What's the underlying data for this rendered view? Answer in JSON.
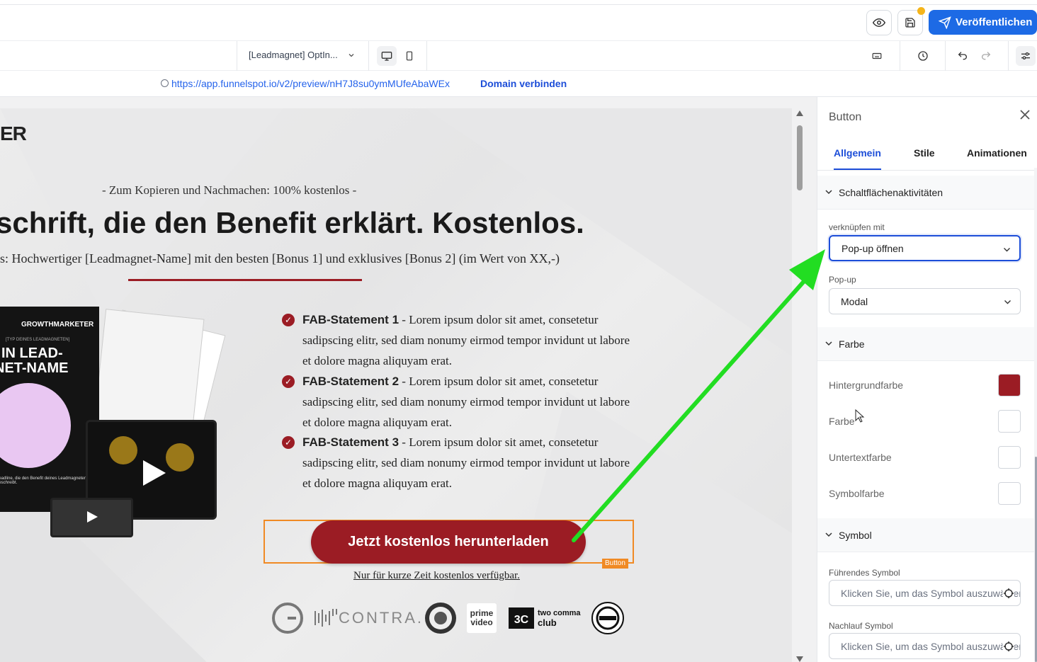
{
  "topbar": {
    "publish_label": "Veröffentlichen"
  },
  "toolbar": {
    "page_select": "[Leadmagnet] OptIn...",
    "url": "https://app.funnelspot.io/v2/preview/nH7J8su0ymMUfeAbaWEx",
    "domain_link": "Domain verbinden"
  },
  "canvas": {
    "logo_fragment": "ER",
    "pre_headline": "- Zum Kopieren und Nachmachen: 100% kostenlos -",
    "headline": "schrift, die den Benefit erklärt. Kostenlos.",
    "subline": "s: Hochwertiger [Leadmagnet-Name] mit den besten [Bonus 1] und exklusives [Bonus 2] (im Wert von XX,-)",
    "fab_items": [
      {
        "title": "FAB-Statement 1",
        "text": " - Lorem ipsum dolor sit amet, consetetur sadipscing elitr, sed diam nonumy eirmod tempor invidunt ut labore et dolore magna aliquyam erat."
      },
      {
        "title": "FAB-Statement 2",
        "text": " - Lorem ipsum dolor sit amet, consetetur sadipscing elitr, sed diam nonumy eirmod tempor invidunt ut labore et dolore magna aliquyam erat."
      },
      {
        "title": "FAB-Statement 3",
        "text": " - Lorem ipsum dolor sit amet, consetetur sadipscing elitr, sed diam nonumy eirmod tempor invidunt ut labore et dolore magna aliquyam erat."
      }
    ],
    "cta_label": "Jetzt kostenlos herunterladen",
    "cta_tag": "Button",
    "cta_sub": "Nur für kurze Zeit kostenlos verfügbar.",
    "book": {
      "brand": "GROWTHMARKETER",
      "tagline": "[TYP DEINES LEADMAGNETEN]",
      "title_line1": "IN LEAD-",
      "title_line2": "NET-NAME",
      "footer": "headline, die den Benefit deines Leadmagneten beschreibt."
    },
    "logos": {
      "contra": "CONTRA.",
      "prime_line1": "prime",
      "prime_line2": "video",
      "tcc_line1": "two comma",
      "tcc_line2": "club"
    }
  },
  "panel": {
    "title": "Button",
    "tabs": [
      "Allgemein",
      "Stile",
      "Animationen"
    ],
    "sections": {
      "actions": "Schaltflächenaktivitäten",
      "color": "Farbe",
      "symbol": "Symbol"
    },
    "link_label": "verknüpfen mit",
    "link_value": "Pop-up öffnen",
    "popup_label": "Pop-up",
    "popup_value": "Modal",
    "colors": {
      "background_label": "Hintergrundfarbe",
      "background_value": "#9b1c24",
      "color_label": "Farbe",
      "subtext_label": "Untertextfarbe",
      "symbol_color_label": "Symbolfarbe"
    },
    "leading_symbol_label": "Führendes Symbol",
    "leading_symbol_placeholder": "Klicken Sie, um das Symbol auszuwählen",
    "trailing_symbol_label": "Nachlauf Symbol",
    "trailing_symbol_placeholder": "Klicken Sie, um das Symbol auszuwählen"
  },
  "annotation": {
    "arrow_color": "#22dd22"
  }
}
